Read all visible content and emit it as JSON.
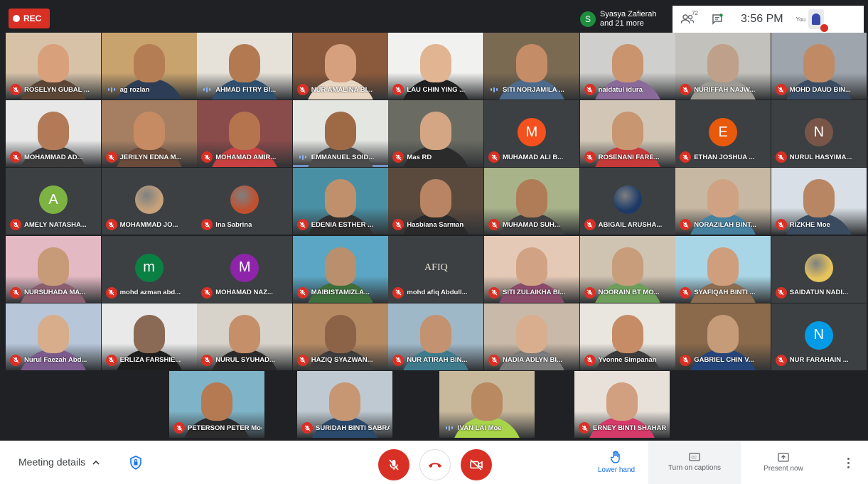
{
  "app": {
    "rec_label": "REC",
    "presenter": {
      "initial": "S",
      "line1": "Syasya Zafierah",
      "line2": "and 21 more"
    },
    "participants_count": "72",
    "time": "3:56 PM",
    "you_label": "You"
  },
  "colors": {
    "mute_red": "#d93025",
    "speaking_blue": "#8ab4f8",
    "accent_blue": "#1a73e8"
  },
  "tiles": [
    {
      "name": "ROSELYN GUBAL ...",
      "status": "muted",
      "kind": "video",
      "bg": "#d7c2a8",
      "skin": "#d9a07c",
      "shirt": "#5b4636"
    },
    {
      "name": "ag rozlan",
      "status": "speaking",
      "kind": "video",
      "bg": "#c9a36e",
      "skin": "#b47d54",
      "shirt": "#2e3d56"
    },
    {
      "name": "AHMAD FITRY BI...",
      "status": "speaking",
      "kind": "video",
      "bg": "#e6e2da",
      "skin": "#b37a52",
      "shirt": "#2f4f6f"
    },
    {
      "name": "NUR AMALINA BI...",
      "status": "muted",
      "kind": "video",
      "bg": "#8b5a3c",
      "skin": "#d6a07e",
      "shirt": "#e9d7c4"
    },
    {
      "name": "LAU CHIN YING ...",
      "status": "muted",
      "kind": "video",
      "bg": "#f1f1ef",
      "skin": "#e1b592",
      "shirt": "#1f1f1f"
    },
    {
      "name": "SITI NORJAMILA ...",
      "status": "speaking",
      "kind": "video",
      "bg": "#7a6a52",
      "skin": "#c48c67",
      "shirt": "#4d6b8c"
    },
    {
      "name": "naidatul idura",
      "status": "muted",
      "kind": "video",
      "bg": "#cfcfcd",
      "skin": "#c9946e",
      "shirt": "#8a6a9a"
    },
    {
      "name": "NURIFFAH NAJW...",
      "status": "muted",
      "kind": "video",
      "bg": "#c2c1bb",
      "skin": "#bfa08a",
      "shirt": "#9c9a93"
    },
    {
      "name": "MOHD DAUD BIN...",
      "status": "muted",
      "kind": "video",
      "bg": "#9ea5ad",
      "skin": "#c08b64",
      "shirt": "#3a4c63"
    },
    {
      "name": "MOHAMMAD AD...",
      "status": "muted",
      "kind": "video",
      "bg": "#e8e8e8",
      "skin": "#b27a56",
      "shirt": "#3b3b3b"
    },
    {
      "name": "JERILYN EDNA M...",
      "status": "muted",
      "kind": "video",
      "bg": "#a67f62",
      "skin": "#c68b62",
      "shirt": "#6a4a3a"
    },
    {
      "name": "MOHAMAD AMIR...",
      "status": "muted",
      "kind": "video",
      "bg": "#8a4b4b",
      "skin": "#b5744e",
      "shirt": "#c94040"
    },
    {
      "name": "EMMANUEL SOID...",
      "status": "speaking",
      "kind": "video",
      "bg": "#e4e6e2",
      "skin": "#9e6a46",
      "shirt": "#4b4b4b",
      "active": true
    },
    {
      "name": "Mas RD",
      "status": "muted",
      "kind": "video",
      "bg": "#6a6c63",
      "skin": "#d4a684",
      "shirt": "#2b2b2b"
    },
    {
      "name": "MUHAMAD ALI B...",
      "status": "muted",
      "kind": "letter",
      "letter": "M",
      "avatar": "#f4511e"
    },
    {
      "name": "ROSENANI FARE...",
      "status": "muted",
      "kind": "video",
      "bg": "#d2c7b6",
      "skin": "#c89670",
      "shirt": "#c73a3a"
    },
    {
      "name": "ETHAN JOSHUA ...",
      "status": "muted",
      "kind": "letter",
      "letter": "E",
      "avatar": "#e8590c"
    },
    {
      "name": "NURUL HASYIMA...",
      "status": "muted",
      "kind": "letter",
      "letter": "N",
      "avatar": "#795548"
    },
    {
      "name": "AMELY NATASHA...",
      "status": "muted",
      "kind": "letter",
      "letter": "A",
      "avatar": "#7cb342"
    },
    {
      "name": "MOHAMMAD JO...",
      "status": "muted",
      "kind": "small",
      "avatar": "#c7a17a"
    },
    {
      "name": "Ina Sabrina",
      "status": "muted",
      "kind": "small",
      "avatar": "#c0502e"
    },
    {
      "name": "EDENIA ESTHER ...",
      "status": "muted",
      "kind": "video",
      "bg": "#4a90a4",
      "skin": "#c0906c",
      "shirt": "#2f2f2f"
    },
    {
      "name": "Hasbiana Sarman",
      "status": "muted",
      "kind": "video",
      "bg": "#5a4a3e",
      "skin": "#b88463",
      "shirt": "#2a2a2a"
    },
    {
      "name": "MUHAMAD SUH...",
      "status": "muted",
      "kind": "video",
      "bg": "#a8b38a",
      "skin": "#b07c58",
      "shirt": "#3f3f3f"
    },
    {
      "name": "ABIGAIL ARUSHA...",
      "status": "muted",
      "kind": "small",
      "avatar": "#1d3a66"
    },
    {
      "name": "NORAZILAH BINT...",
      "status": "muted",
      "kind": "video",
      "bg": "#c7b8a3",
      "skin": "#cfa283",
      "shirt": "#46829f"
    },
    {
      "name": "RIZKHE Moe",
      "status": "muted",
      "kind": "video",
      "bg": "#d8dfe6",
      "skin": "#b98663",
      "shirt": "#3a4a5f"
    },
    {
      "name": "NURSUHADA MA...",
      "status": "muted",
      "kind": "video",
      "bg": "#e3b9c4",
      "skin": "#c79a78",
      "shirt": "#8a5f6f"
    },
    {
      "name": "mohd azman abd...",
      "status": "muted",
      "kind": "letter",
      "letter": "m",
      "avatar": "#0b8043"
    },
    {
      "name": "MOHAMAD NAZ...",
      "status": "muted",
      "kind": "letter",
      "letter": "M",
      "avatar": "#8e24aa"
    },
    {
      "name": "MAIBISTAMIZLA...",
      "status": "muted",
      "kind": "video",
      "bg": "#5aa6c4",
      "skin": "#b98f6e",
      "shirt": "#3d6e3b"
    },
    {
      "name": "mohd afiq Abdull...",
      "status": "muted",
      "kind": "logo",
      "logo": "AFIQ"
    },
    {
      "name": "SITI ZULAIKHA BI...",
      "status": "muted",
      "kind": "video",
      "bg": "#e5c9b7",
      "skin": "#d1a384",
      "shirt": "#8a4a6a"
    },
    {
      "name": "NOORAIN BT MO...",
      "status": "muted",
      "kind": "video",
      "bg": "#cfc3b1",
      "skin": "#c89d7c",
      "shirt": "#6d9f5a"
    },
    {
      "name": "SYAFIQAH BINTI ...",
      "status": "muted",
      "kind": "video",
      "bg": "#a9d6e6",
      "skin": "#cf9e7d",
      "shirt": "#8a6d52"
    },
    {
      "name": "SAIDATUN NADI...",
      "status": "muted",
      "kind": "small",
      "avatar": "#e6c35c"
    },
    {
      "name": "Nurul Faezah Abd...",
      "status": "muted",
      "kind": "video",
      "bg": "#b7c6d9",
      "skin": "#d7ad8c",
      "shirt": "#7b5a8c"
    },
    {
      "name": "ERLIZA FARSHIE...",
      "status": "muted",
      "kind": "video",
      "bg": "#e9e9e9",
      "skin": "#8a6a55",
      "shirt": "#1e1e1e"
    },
    {
      "name": "NURUL SYUHAD...",
      "status": "muted",
      "kind": "video",
      "bg": "#d7d2ca",
      "skin": "#c58f69",
      "shirt": "#2a2a2a"
    },
    {
      "name": "HAZIQ SYAZWAN...",
      "status": "muted",
      "kind": "video",
      "bg": "#b58a63",
      "skin": "#8c6347",
      "shirt": "#3c3c3c"
    },
    {
      "name": "NUR ATIRAH BIN...",
      "status": "muted",
      "kind": "video",
      "bg": "#9fb8c8",
      "skin": "#c39271",
      "shirt": "#3c7a8c"
    },
    {
      "name": "NADIA ADLYN BI...",
      "status": "muted",
      "kind": "video",
      "bg": "#c9b9a8",
      "skin": "#d9ae8f",
      "shirt": "#7a7a7a"
    },
    {
      "name": "Yvonne Simpanan",
      "status": "muted",
      "kind": "video",
      "bg": "#e9e5df",
      "skin": "#c68c66",
      "shirt": "#3b3b3b"
    },
    {
      "name": "GABRIEL CHIN V...",
      "status": "muted",
      "kind": "video",
      "bg": "#8a6a4a",
      "skin": "#c59b78",
      "shirt": "#24457a"
    },
    {
      "name": "NUR FARAHAIN ...",
      "status": "muted",
      "kind": "letter",
      "letter": "N",
      "avatar": "#039be5"
    },
    {
      "name": "PETERSON PETER Moe",
      "status": "muted",
      "kind": "video",
      "bg": "#7fb4c8",
      "skin": "#b57a52",
      "shirt": "#2b2b2b"
    },
    {
      "name": "SURIDAH BINTI SABRAN Moe",
      "status": "muted",
      "kind": "video",
      "bg": "#bfc9d1",
      "skin": "#c79774",
      "shirt": "#2b4a6b"
    },
    {
      "name": "IVAN LAI Moe",
      "status": "speaking",
      "kind": "video",
      "bg": "#c9b99c",
      "skin": "#b98a62",
      "shirt": "#a8d44a"
    },
    {
      "name": "ERNEY BINTI SHAHARMAN...",
      "status": "muted",
      "kind": "video",
      "bg": "#e8e1da",
      "skin": "#d0a080",
      "shirt": "#d63a6a"
    }
  ],
  "bottom": {
    "meeting_details": "Meeting details",
    "lower_hand": "Lower hand",
    "captions": "Turn on captions",
    "present": "Present now"
  }
}
